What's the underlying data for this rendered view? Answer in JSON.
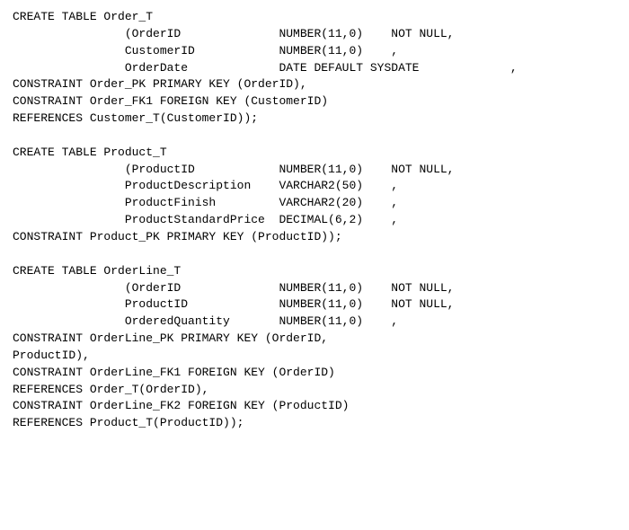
{
  "code": {
    "content": "CREATE TABLE Order_T\n                (OrderID              NUMBER(11,0)    NOT NULL,\n                CustomerID            NUMBER(11,0)    ,\n                OrderDate             DATE DEFAULT SYSDATE             ,\nCONSTRAINT Order_PK PRIMARY KEY (OrderID),\nCONSTRAINT Order_FK1 FOREIGN KEY (CustomerID)\nREFERENCES Customer_T(CustomerID));\n\nCREATE TABLE Product_T\n                (ProductID            NUMBER(11,0)    NOT NULL,\n                ProductDescription    VARCHAR2(50)    ,\n                ProductFinish         VARCHAR2(20)    ,\n                ProductStandardPrice  DECIMAL(6,2)    ,\nCONSTRAINT Product_PK PRIMARY KEY (ProductID));\n\nCREATE TABLE OrderLine_T\n                (OrderID              NUMBER(11,0)    NOT NULL,\n                ProductID             NUMBER(11,0)    NOT NULL,\n                OrderedQuantity       NUMBER(11,0)    ,\nCONSTRAINT OrderLine_PK PRIMARY KEY (OrderID,\nProductID),\nCONSTRAINT OrderLine_FK1 FOREIGN KEY (OrderID)\nREFERENCES Order_T(OrderID),\nCONSTRAINT OrderLine_FK2 FOREIGN KEY (ProductID)\nREFERENCES Product_T(ProductID));"
  }
}
